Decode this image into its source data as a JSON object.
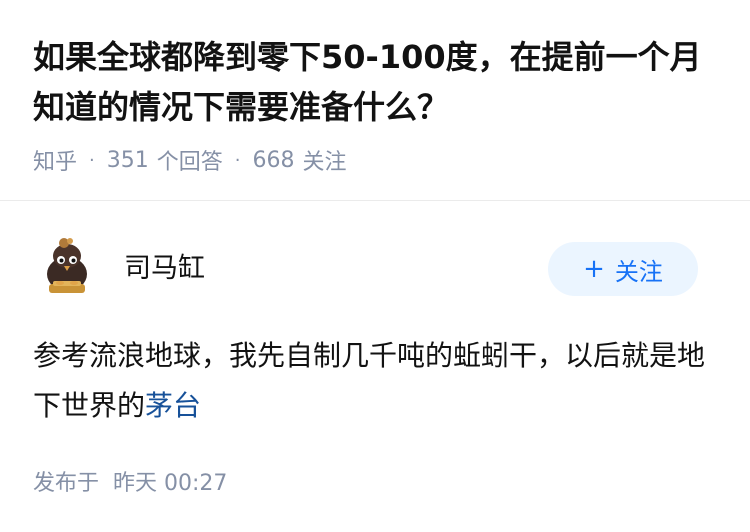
{
  "question": {
    "title": "如果全球都降到零下50-100度，在提前一个月知道的情况下需要准备什么？",
    "source": "知乎",
    "answer_count": "351",
    "answer_label": "个回答",
    "follower_count": "668",
    "follower_label": "关注"
  },
  "answer": {
    "author_name": "司马缸",
    "follow_button_label": "关注",
    "content_text": "参考流浪地球，我先自制几千吨的蚯蚓干，以后就是地下世界的",
    "content_link": "茅台",
    "published_label": "发布于",
    "published_time": "昨天 00:27"
  },
  "colors": {
    "title": "#121212",
    "meta": "#8590a6",
    "follow_bg": "#ebf5ff",
    "follow_text": "#1772f6",
    "link": "#175199"
  },
  "icons": {
    "avatar": "cartoon-character-avatar",
    "follow": "plus-icon"
  }
}
